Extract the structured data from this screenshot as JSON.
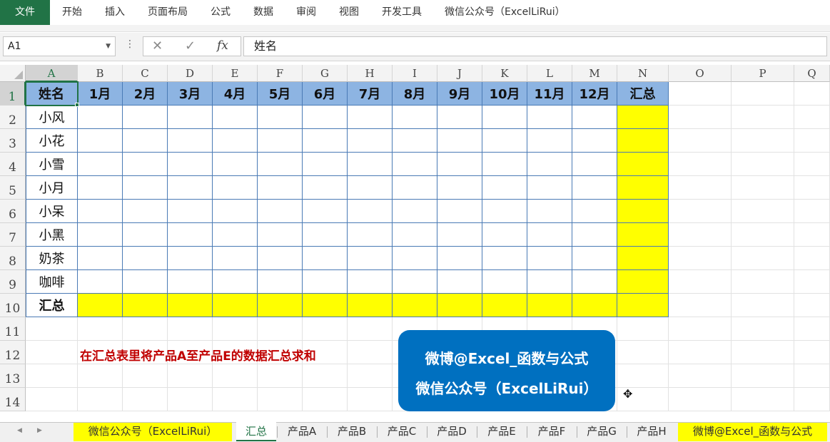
{
  "ribbon": {
    "tabs": [
      "文件",
      "开始",
      "插入",
      "页面布局",
      "公式",
      "数据",
      "审阅",
      "视图",
      "开发工具",
      "微信公众号（ExcelLiRui）"
    ]
  },
  "formula_bar": {
    "name_box": "A1",
    "cancel_icon": "✕",
    "enter_icon": "✓",
    "fx_label": "fx",
    "content": "姓名"
  },
  "grid": {
    "columns": [
      "A",
      "B",
      "C",
      "D",
      "E",
      "F",
      "G",
      "H",
      "I",
      "J",
      "K",
      "L",
      "M",
      "N",
      "O",
      "P",
      "Q"
    ],
    "rows": [
      "1",
      "2",
      "3",
      "4",
      "5",
      "6",
      "7",
      "8",
      "9",
      "10",
      "11",
      "12",
      "13",
      "14"
    ],
    "header_row": [
      "姓名",
      "1月",
      "2月",
      "3月",
      "4月",
      "5月",
      "6月",
      "7月",
      "8月",
      "9月",
      "10月",
      "11月",
      "12月",
      "汇总"
    ],
    "names": [
      "小风",
      "小花",
      "小雪",
      "小月",
      "小呆",
      "小黑",
      "奶茶",
      "咖啡"
    ],
    "total_label": "汇总",
    "colors": {
      "header": "#8db4e2",
      "highlight": "#ffff00",
      "border": "#4a7ab5"
    }
  },
  "annotation": {
    "note": "在汇总表里将产品A至产品E的数据汇总求和",
    "badge_line1": "微博@Excel_函数与公式",
    "badge_line2": "微信公众号（ExcelLiRui）",
    "badge_color": "#0070c0"
  },
  "sheet_tabs": [
    "微信公众号（ExcelLiRui）",
    "汇总",
    "产品A",
    "产品B",
    "产品C",
    "产品D",
    "产品E",
    "产品F",
    "产品G",
    "产品H",
    "微博@Excel_函数与公式"
  ],
  "active_sheet": "汇总"
}
